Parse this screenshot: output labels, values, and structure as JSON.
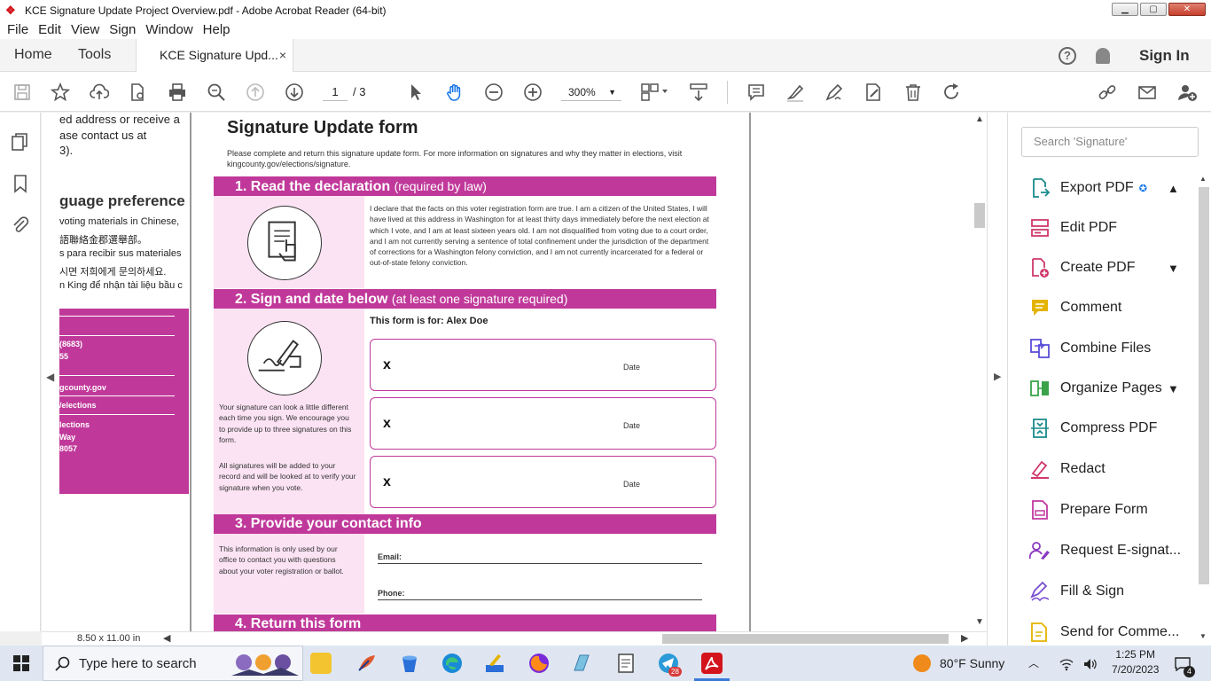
{
  "window": {
    "title": "KCE Signature Update Project Overview.pdf - Adobe Acrobat Reader (64-bit)",
    "controls": {
      "minimize": "▁",
      "restore": "▢",
      "close": "✕"
    }
  },
  "menu": [
    "File",
    "Edit",
    "View",
    "Sign",
    "Window",
    "Help"
  ],
  "tabs": {
    "home": "Home",
    "tools": "Tools",
    "document": "KCE Signature Upd...",
    "close": "×",
    "help": "?",
    "sign_in": "Sign In"
  },
  "toolbar": {
    "page_current": "1",
    "page_total": "/ 3",
    "zoom": "300%"
  },
  "left_page": {
    "lines": [
      "ed address or receive a",
      "ase contact us at",
      "3)."
    ],
    "heading": "guage preference",
    "lang_lines": [
      "voting materials in Chinese,",
      "語聯絡金郡選舉部。",
      "s para recibir sus materiales",
      "시면 저희에게 문의하세요.",
      "n King để nhận tài liệu bầu c"
    ],
    "band_lines": [
      "(8683)",
      "55",
      "gcounty.gov",
      "/elections",
      "lections",
      "Way",
      "8057"
    ]
  },
  "form": {
    "title": "Signature Update form",
    "intro": "Please complete and return this signature update form. For more information on signatures and why they matter in elections, visit kingcounty.gov/elections/signature.",
    "section1": {
      "main": "1. Read the declaration",
      "sub": "(required by law)"
    },
    "declaration": "I declare that the facts on this voter registration form are true. I am a citizen of the United States, I will have lived at this address in Washington for at least thirty days immediately before the next election at which I vote, and I am at least sixteen years old. I am not disqualified from voting due to a court order, and I am not currently serving a sentence of total confinement under the jurisdiction of the department of corrections for a Washington felony conviction, and I am not currently incarcerated for a federal or out-of-state felony conviction.",
    "section2": {
      "main": "2. Sign and date below",
      "sub": "(at least one signature required)"
    },
    "form_for": "This form is for: Alex Doe",
    "sig_mark": "x",
    "date_label": "Date",
    "note1": "Your signature can look a little different each time you sign. We encourage you to provide up to three signatures on this form.",
    "note2": "All signatures will be added to your record and will be looked at to verify your signature when you vote.",
    "section3": {
      "main": "3. Provide your contact info"
    },
    "contact_note": "This information is only used by our office to contact you with questions about your voter registration or ballot.",
    "email_label": "Email:",
    "phone_label": "Phone:",
    "section4": {
      "main": "4. Return this form"
    }
  },
  "statusbar": {
    "page_size": "8.50 x 11.00 in"
  },
  "right_panel": {
    "search_placeholder": "Search 'Signature'",
    "tools": [
      {
        "label": "Export PDF",
        "color": "#1a8a8a"
      },
      {
        "label": "Edit PDF",
        "color": "#d0386b"
      },
      {
        "label": "Create PDF",
        "color": "#d0386b"
      },
      {
        "label": "Comment",
        "color": "#e4b400"
      },
      {
        "label": "Combine Files",
        "color": "#5b4fd8"
      },
      {
        "label": "Organize Pages",
        "color": "#3aa34a"
      },
      {
        "label": "Compress PDF",
        "color": "#1a8a8a"
      },
      {
        "label": "Redact",
        "color": "#d0386b"
      },
      {
        "label": "Prepare Form",
        "color": "#c03aa0"
      },
      {
        "label": "Request E-signat...",
        "color": "#8a3ac0"
      },
      {
        "label": "Fill & Sign",
        "color": "#7a4fd0"
      },
      {
        "label": "Send for Comme...",
        "color": "#e4b400"
      }
    ]
  },
  "taskbar": {
    "search_placeholder": "Type here to search",
    "weather": "80°F  Sunny",
    "time": "1:25 PM",
    "date": "7/20/2023",
    "notif_count": "4",
    "telegram_badge": "28"
  }
}
